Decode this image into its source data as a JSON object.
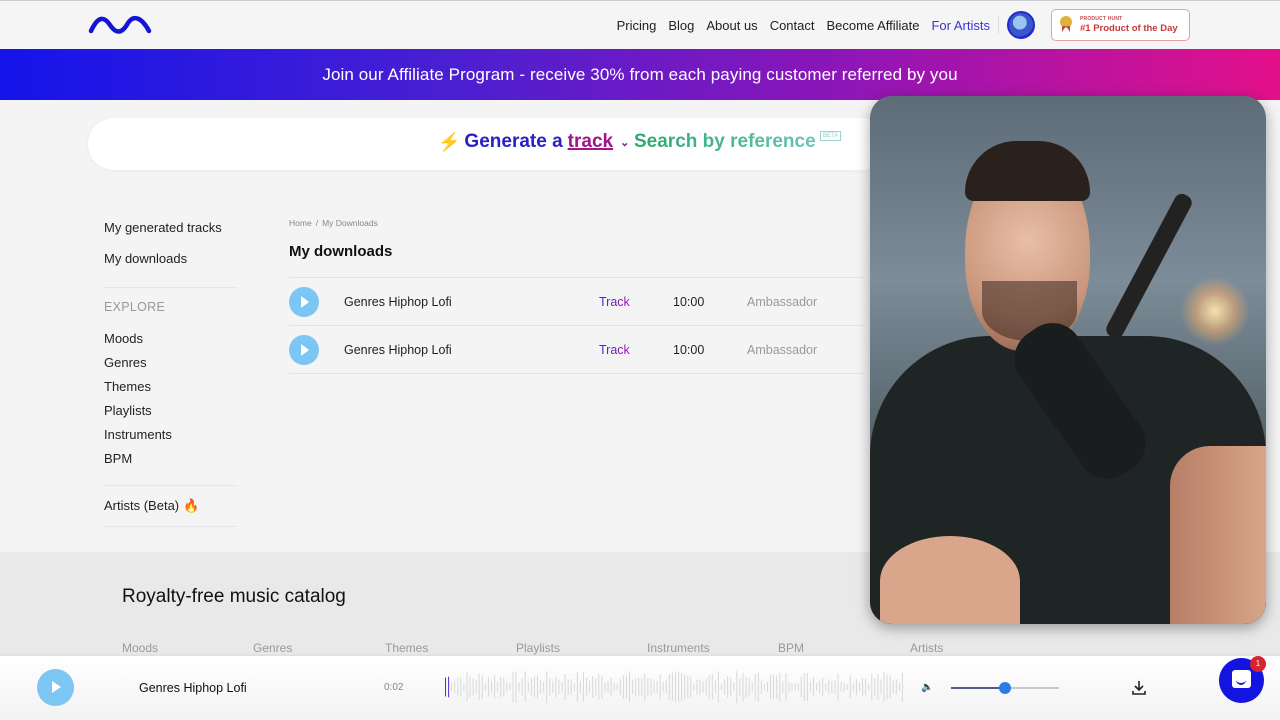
{
  "header": {
    "logo": "wave-logo",
    "nav": [
      "Pricing",
      "Blog",
      "About us",
      "Contact",
      "Become Affiliate",
      "For Artists"
    ],
    "badge": {
      "small": "PRODUCT HUNT",
      "big": "#1 Product of the Day"
    }
  },
  "banner": {
    "text": "Join our Affiliate Program - receive 30% from each paying customer referred by you"
  },
  "search": {
    "generate_prefix": "Generate a",
    "generate_word": "track",
    "search_reference": "Search by reference",
    "beta": "BETA"
  },
  "sidebar": {
    "main": [
      "My generated tracks",
      "My downloads"
    ],
    "explore_heading": "EXPLORE",
    "explore": [
      "Moods",
      "Genres",
      "Themes",
      "Playlists",
      "Instruments",
      "BPM"
    ],
    "artists": "Artists (Beta)"
  },
  "main": {
    "breadcrumb": [
      "Home",
      "My Downloads"
    ],
    "title": "My downloads",
    "rows": [
      {
        "name": "Genres Hiphop Lofi",
        "type": "Track",
        "duration": "10:00",
        "license": "Ambassador"
      },
      {
        "name": "Genres Hiphop Lofi",
        "type": "Track",
        "duration": "10:00",
        "license": "Ambassador"
      }
    ]
  },
  "catalog": {
    "title": "Royalty-free music catalog",
    "tabs": [
      "Moods",
      "Genres",
      "Themes",
      "Playlists",
      "Instruments",
      "BPM",
      "Artists"
    ]
  },
  "player": {
    "track": "Genres Hiphop Lofi",
    "time": "0:02",
    "progress": 0.01,
    "volume": 0.5
  },
  "chat": {
    "unread": "1"
  },
  "colors": {
    "brand_blue": "#1414e0",
    "accent_purple": "#3b32d6",
    "play_blue": "#7cc6f3",
    "badge_red": "#d6232f"
  }
}
